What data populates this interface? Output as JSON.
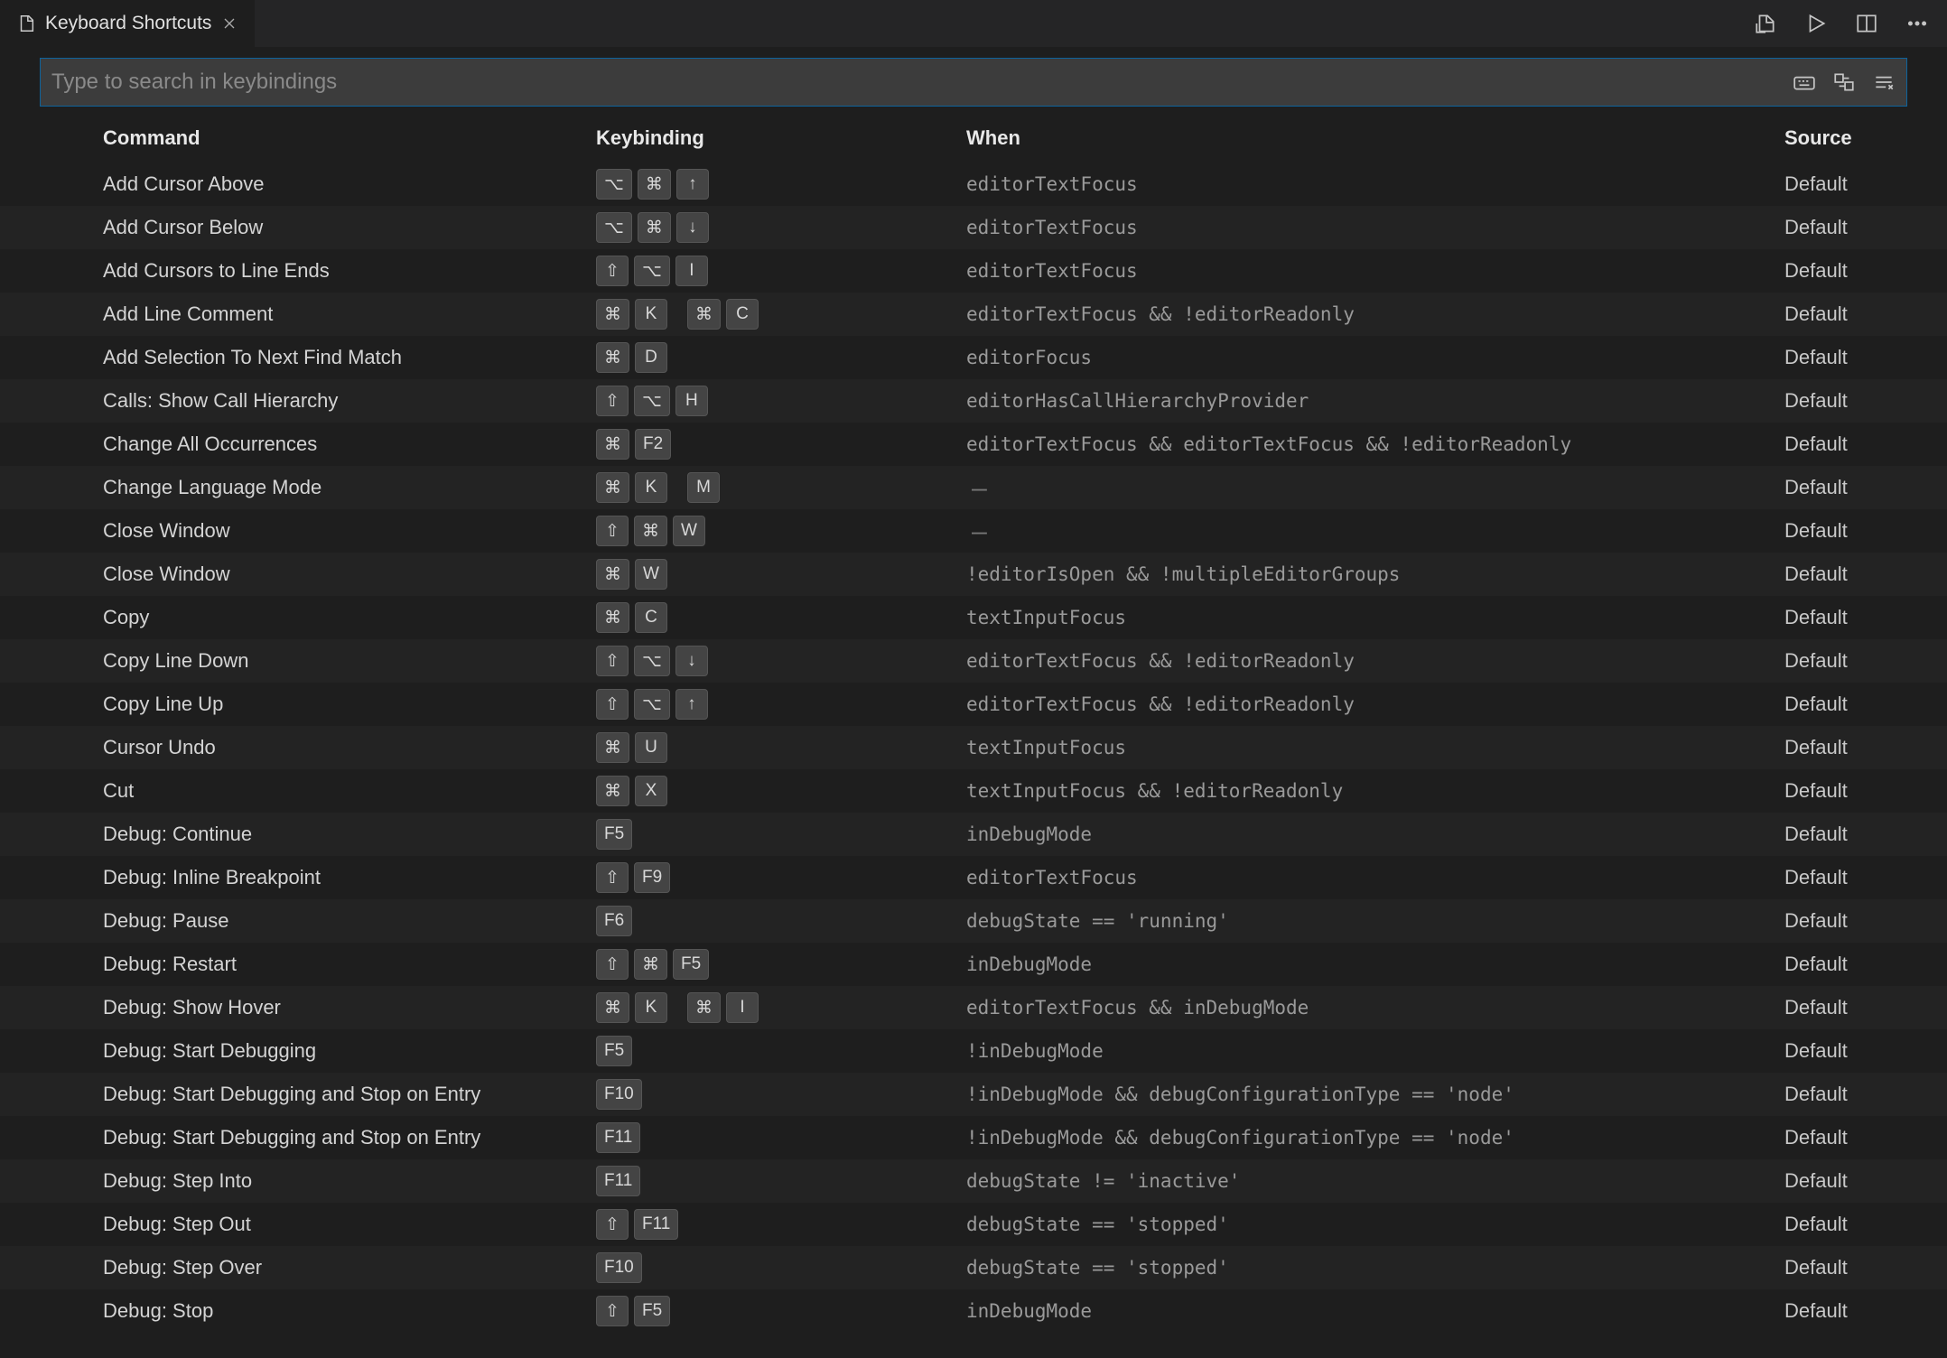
{
  "tab": {
    "title": "Keyboard Shortcuts"
  },
  "search": {
    "placeholder": "Type to search in keybindings"
  },
  "headers": {
    "command": "Command",
    "keybinding": "Keybinding",
    "when": "When",
    "source": "Source"
  },
  "rows": [
    {
      "command": "Add Cursor Above",
      "keys": [
        [
          "⌥",
          "⌘",
          "↑"
        ]
      ],
      "when": "editorTextFocus",
      "source": "Default"
    },
    {
      "command": "Add Cursor Below",
      "keys": [
        [
          "⌥",
          "⌘",
          "↓"
        ]
      ],
      "when": "editorTextFocus",
      "source": "Default"
    },
    {
      "command": "Add Cursors to Line Ends",
      "keys": [
        [
          "⇧",
          "⌥",
          "I"
        ]
      ],
      "when": "editorTextFocus",
      "source": "Default"
    },
    {
      "command": "Add Line Comment",
      "keys": [
        [
          "⌘",
          "K"
        ],
        [
          "⌘",
          "C"
        ]
      ],
      "when": "editorTextFocus && !editorReadonly",
      "source": "Default"
    },
    {
      "command": "Add Selection To Next Find Match",
      "keys": [
        [
          "⌘",
          "D"
        ]
      ],
      "when": "editorFocus",
      "source": "Default"
    },
    {
      "command": "Calls: Show Call Hierarchy",
      "keys": [
        [
          "⇧",
          "⌥",
          "H"
        ]
      ],
      "when": "editorHasCallHierarchyProvider",
      "source": "Default"
    },
    {
      "command": "Change All Occurrences",
      "keys": [
        [
          "⌘",
          "F2"
        ]
      ],
      "when": "editorTextFocus && editorTextFocus && !editorReadonly",
      "source": "Default"
    },
    {
      "command": "Change Language Mode",
      "keys": [
        [
          "⌘",
          "K"
        ],
        [
          "M"
        ]
      ],
      "when": "—",
      "source": "Default"
    },
    {
      "command": "Close Window",
      "keys": [
        [
          "⇧",
          "⌘",
          "W"
        ]
      ],
      "when": "—",
      "source": "Default"
    },
    {
      "command": "Close Window",
      "keys": [
        [
          "⌘",
          "W"
        ]
      ],
      "when": "!editorIsOpen && !multipleEditorGroups",
      "source": "Default"
    },
    {
      "command": "Copy",
      "keys": [
        [
          "⌘",
          "C"
        ]
      ],
      "when": "textInputFocus",
      "source": "Default"
    },
    {
      "command": "Copy Line Down",
      "keys": [
        [
          "⇧",
          "⌥",
          "↓"
        ]
      ],
      "when": "editorTextFocus && !editorReadonly",
      "source": "Default"
    },
    {
      "command": "Copy Line Up",
      "keys": [
        [
          "⇧",
          "⌥",
          "↑"
        ]
      ],
      "when": "editorTextFocus && !editorReadonly",
      "source": "Default"
    },
    {
      "command": "Cursor Undo",
      "keys": [
        [
          "⌘",
          "U"
        ]
      ],
      "when": "textInputFocus",
      "source": "Default"
    },
    {
      "command": "Cut",
      "keys": [
        [
          "⌘",
          "X"
        ]
      ],
      "when": "textInputFocus && !editorReadonly",
      "source": "Default"
    },
    {
      "command": "Debug: Continue",
      "keys": [
        [
          "F5"
        ]
      ],
      "when": "inDebugMode",
      "source": "Default"
    },
    {
      "command": "Debug: Inline Breakpoint",
      "keys": [
        [
          "⇧",
          "F9"
        ]
      ],
      "when": "editorTextFocus",
      "source": "Default"
    },
    {
      "command": "Debug: Pause",
      "keys": [
        [
          "F6"
        ]
      ],
      "when": "debugState == 'running'",
      "source": "Default"
    },
    {
      "command": "Debug: Restart",
      "keys": [
        [
          "⇧",
          "⌘",
          "F5"
        ]
      ],
      "when": "inDebugMode",
      "source": "Default"
    },
    {
      "command": "Debug: Show Hover",
      "keys": [
        [
          "⌘",
          "K"
        ],
        [
          "⌘",
          "I"
        ]
      ],
      "when": "editorTextFocus && inDebugMode",
      "source": "Default"
    },
    {
      "command": "Debug: Start Debugging",
      "keys": [
        [
          "F5"
        ]
      ],
      "when": "!inDebugMode",
      "source": "Default"
    },
    {
      "command": "Debug: Start Debugging and Stop on Entry",
      "keys": [
        [
          "F10"
        ]
      ],
      "when": "!inDebugMode && debugConfigurationType == 'node'",
      "source": "Default"
    },
    {
      "command": "Debug: Start Debugging and Stop on Entry",
      "keys": [
        [
          "F11"
        ]
      ],
      "when": "!inDebugMode && debugConfigurationType == 'node'",
      "source": "Default"
    },
    {
      "command": "Debug: Step Into",
      "keys": [
        [
          "F11"
        ]
      ],
      "when": "debugState != 'inactive'",
      "source": "Default"
    },
    {
      "command": "Debug: Step Out",
      "keys": [
        [
          "⇧",
          "F11"
        ]
      ],
      "when": "debugState == 'stopped'",
      "source": "Default"
    },
    {
      "command": "Debug: Step Over",
      "keys": [
        [
          "F10"
        ]
      ],
      "when": "debugState == 'stopped'",
      "source": "Default"
    },
    {
      "command": "Debug: Stop",
      "keys": [
        [
          "⇧",
          "F5"
        ]
      ],
      "when": "inDebugMode",
      "source": "Default"
    }
  ]
}
